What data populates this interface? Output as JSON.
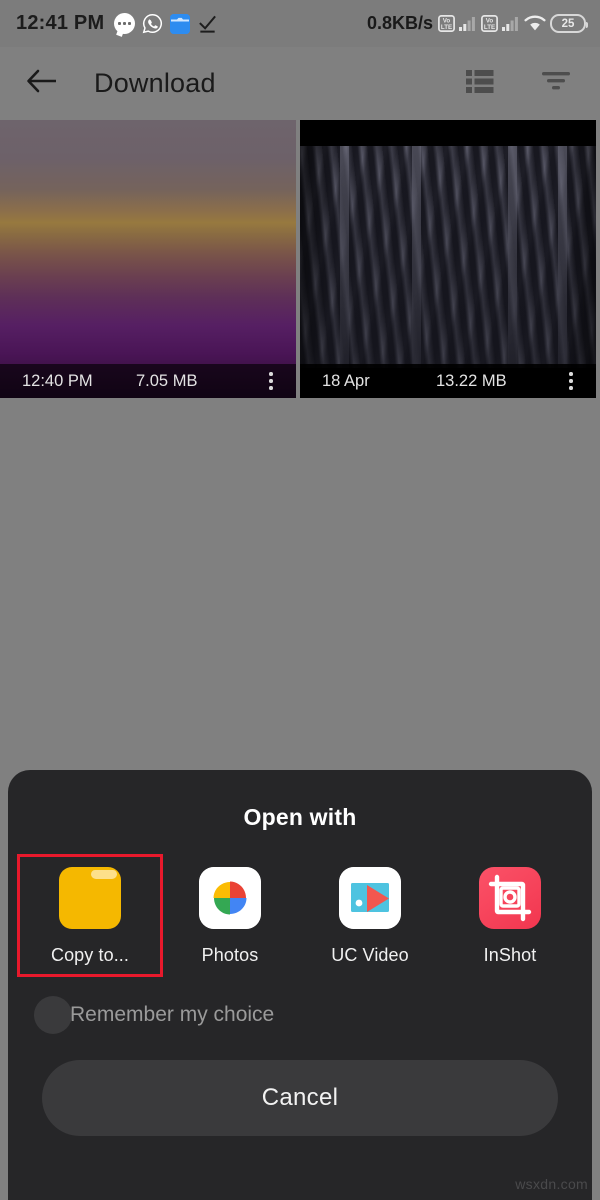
{
  "status_bar": {
    "clock": "12:41 PM",
    "network_speed": "0.8KB/s",
    "battery_level": "25",
    "left_icons": [
      "chat-bubble-icon",
      "whatsapp-icon",
      "gallery-icon",
      "checkmark-icon"
    ],
    "right_icons": [
      "volte-sim1-icon",
      "signal-sim1-icon",
      "volte-sim2-icon",
      "signal-sim2-icon",
      "wifi-icon",
      "battery-icon"
    ]
  },
  "toolbar": {
    "back_icon": "arrow-left-icon",
    "title": "Download",
    "view_toggle_icon": "list-view-icon",
    "sort_icon": "sort-filter-icon"
  },
  "grid": {
    "items": [
      {
        "date": "12:40 PM",
        "size": "7.05 MB",
        "menu_icon": "overflow-menu-icon",
        "thumbnail": "sunset-gradient-photo"
      },
      {
        "date": "18 Apr",
        "size": "13.22 MB",
        "menu_icon": "overflow-menu-icon",
        "thumbnail": "snowy-forest-photo"
      }
    ]
  },
  "dialog": {
    "title": "Open with",
    "apps": [
      {
        "label": "Copy to...",
        "icon": "folder-icon",
        "selected": true
      },
      {
        "label": "Photos",
        "icon": "google-photos-icon",
        "selected": false
      },
      {
        "label": "UC Video",
        "icon": "uc-video-icon",
        "selected": false
      },
      {
        "label": "InShot",
        "icon": "inshot-icon",
        "selected": false
      }
    ],
    "remember_label": "Remember my choice",
    "remember_checked": false,
    "cancel_label": "Cancel"
  },
  "watermark": "wsxdn.com",
  "colors": {
    "status_bar_bg": "#7c7c7c",
    "scrim": "#808080",
    "dialog_bg": "#262628",
    "selection_outline": "#e8192c",
    "folder_yellow": "#f5b800",
    "inshot_red": "#f2364f",
    "button_bg": "#3a3a3c"
  }
}
